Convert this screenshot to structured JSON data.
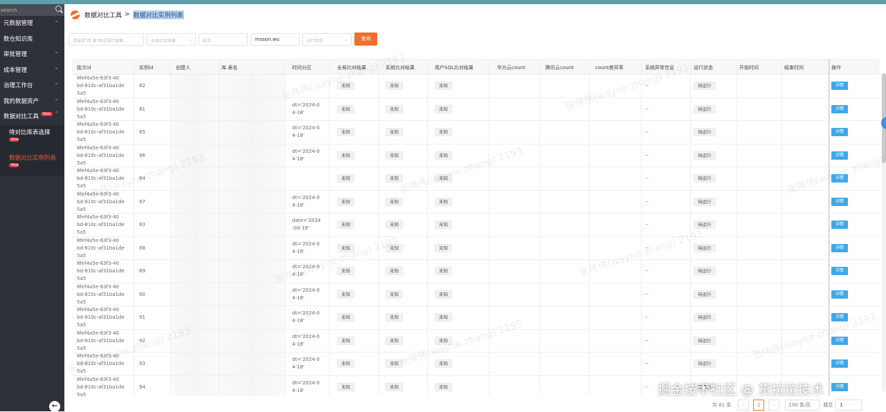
{
  "sidebar": {
    "search_placeholder": "search",
    "items": [
      {
        "label": "元数据管理"
      },
      {
        "label": "数仓知识库"
      },
      {
        "label": "审批管理"
      },
      {
        "label": "成本管理"
      },
      {
        "label": "治理工作台"
      },
      {
        "label": "我的数据资产"
      },
      {
        "label": "数据对比工具",
        "badge": "New"
      }
    ],
    "subitems": [
      {
        "label": "待对比库表选择",
        "badge": "New"
      },
      {
        "label": "数据对比实例列表",
        "badge": "New"
      }
    ]
  },
  "breadcrumb": {
    "parent": "数据对比工具",
    "separator": ">",
    "current": "数据对比实例列表"
  },
  "filters": {
    "f1_placeholder": "请按照\"库.表\"格式进行搜索...",
    "f2_placeholder": "全局比对结果",
    "f3_placeholder": "批次",
    "f4_value": "mason.wu",
    "f5_placeholder": "运行状态",
    "query_label": "查询"
  },
  "table": {
    "headers": [
      "批次id",
      "实例id",
      "创建人",
      "库.表名",
      "时间分区",
      "全局比对结果",
      "系统比对结果",
      "用户SQL比对结果",
      "华为云count",
      "腾讯云count",
      "count差异率",
      "系统异常信息",
      "运行状态",
      "开始时间",
      "结束时间",
      "操作"
    ],
    "rows": [
      {
        "batch": [
          "8fef4a5e-63f3-40",
          "bd-810c-af31ba1de",
          "5a5"
        ],
        "id": "82",
        "part": [
          "",
          ""
        ],
        "err": "--",
        "status": "待运行",
        "action": "详情"
      },
      {
        "batch": [
          "8fef4a5e-63f3-40",
          "bd-810c-af31ba1de",
          "5a5"
        ],
        "id": "81",
        "part": [
          "dt='2024-0",
          "4-18'"
        ],
        "err": "--",
        "status": "待运行",
        "action": "详情"
      },
      {
        "batch": [
          "8fef4a5e-63f3-40",
          "bd-810c-af31ba1de",
          "5a5"
        ],
        "id": "65",
        "part": [
          "dt='2024-0",
          "4-18'"
        ],
        "err": "--",
        "status": "待运行",
        "action": "详情"
      },
      {
        "batch": [
          "8fef4a5e-63f3-40",
          "bd-810c-af31ba1de",
          "5a5"
        ],
        "id": "86",
        "part": [
          "dt='2024-0",
          "4-18'"
        ],
        "err": "--",
        "status": "待运行",
        "action": "详情"
      },
      {
        "batch": [
          "8fef4a5e-63f3-40",
          "bd-810c-af31ba1de",
          "5a5"
        ],
        "id": "84",
        "part": [
          "",
          ""
        ],
        "err": "--",
        "status": "待运行",
        "action": "详情"
      },
      {
        "batch": [
          "8fef4a5e-63f3-40",
          "bd-810c-af31ba1de",
          "5a5"
        ],
        "id": "87",
        "part": [
          "dt='2024-0",
          "4-18'"
        ],
        "err": "--",
        "status": "待运行",
        "action": "详情"
      },
      {
        "batch": [
          "8fef4a5e-63f3-40",
          "bd-810c-af31ba1de",
          "5a5"
        ],
        "id": "83",
        "part": [
          "date='2024",
          "-04-18'"
        ],
        "err": "--",
        "status": "待运行",
        "action": "详情"
      },
      {
        "batch": [
          "8fef4a5e-63f3-40",
          "bd-810c-af31ba1de",
          "5a5"
        ],
        "id": "88",
        "part": [
          "dt='2024-0",
          "4-18'"
        ],
        "err": "--",
        "status": "待运行",
        "action": "详情"
      },
      {
        "batch": [
          "8fef4a5e-63f3-40",
          "bd-810c-af31ba1de",
          "5a5"
        ],
        "id": "89",
        "part": [
          "dt='2024-0",
          "4-18'"
        ],
        "err": "--",
        "status": "待运行",
        "action": "详情"
      },
      {
        "batch": [
          "8fef4a5e-63f3-40",
          "bd-810c-af31ba1de",
          "5a5"
        ],
        "id": "90",
        "part": [
          "dt='2024-0",
          "4-18'"
        ],
        "err": "--",
        "status": "待运行",
        "action": "详情"
      },
      {
        "batch": [
          "8fef4a5e-63f3-40",
          "bd-810c-af31ba1de",
          "5a5"
        ],
        "id": "91",
        "part": [
          "dt='2024-0",
          "4-18'"
        ],
        "err": "--",
        "status": "待运行",
        "action": "详情"
      },
      {
        "batch": [
          "8fef4a5e-63f3-40",
          "bd-810c-af31ba1de",
          "5a5"
        ],
        "id": "92",
        "part": [
          "dt='2024-0",
          "4-18'"
        ],
        "err": "--",
        "status": "待运行",
        "action": "详情"
      },
      {
        "batch": [
          "8fef4a5e-63f3-40",
          "bd-810c-af31ba1de",
          "5a5"
        ],
        "id": "93",
        "part": [
          "dt='2024-0",
          "4-18'"
        ],
        "err": "--",
        "status": "待运行",
        "action": "详情"
      },
      {
        "batch": [
          "8fef4a5e-63f3-40",
          "bd-810c-af31ba1de",
          "5a5"
        ],
        "id": "94",
        "part": [
          "dt='2024-0",
          "4-18'"
        ],
        "err": "--",
        "status": "待运行",
        "action": "详情"
      }
    ],
    "result_tag": "未知"
  },
  "pager": {
    "total": "共 81 条",
    "page": "1",
    "size": "100 条/页",
    "goto_label": "跳至",
    "goto_value": "1"
  },
  "watermark_text": "张伟伟(wayne.zhang) 2193",
  "brand_overlay": "掘金技术社区 @ 货拉拉技术",
  "colors": {
    "accent": "#f06f2e",
    "sidebar_bg": "#2e3138",
    "detail_button": "#3fa8e8",
    "active_menu": "#ef5a2a"
  }
}
